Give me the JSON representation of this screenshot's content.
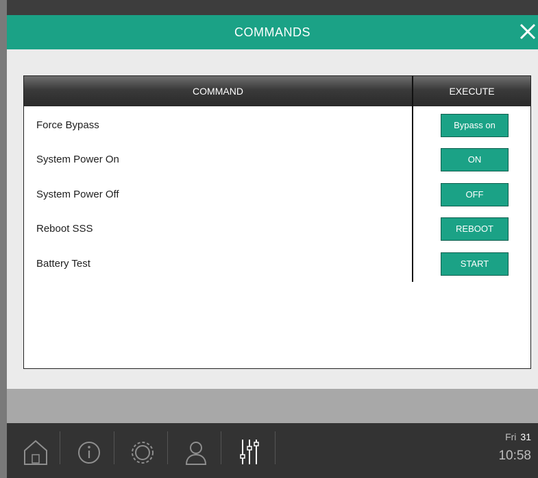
{
  "header": {
    "title": "COMMANDS"
  },
  "table": {
    "columns": [
      "COMMAND",
      "EXECUTE"
    ],
    "rows": [
      {
        "command": "Force Bypass",
        "action": "Bypass on"
      },
      {
        "command": "System Power On",
        "action": "ON"
      },
      {
        "command": "System Power Off",
        "action": "OFF"
      },
      {
        "command": "Reboot SSS",
        "action": "REBOOT"
      },
      {
        "command": "Battery Test",
        "action": "START"
      }
    ]
  },
  "navbar": {
    "items": [
      "home-icon",
      "info-icon",
      "gear-icon",
      "user-icon",
      "sliders-icon"
    ]
  },
  "status": {
    "day": "Fri",
    "date": "31",
    "time": "10:58"
  },
  "colors": {
    "accent": "#1ba286",
    "header": "#2a2a2a",
    "panel": "#ebebeb",
    "bar": "#333333"
  }
}
